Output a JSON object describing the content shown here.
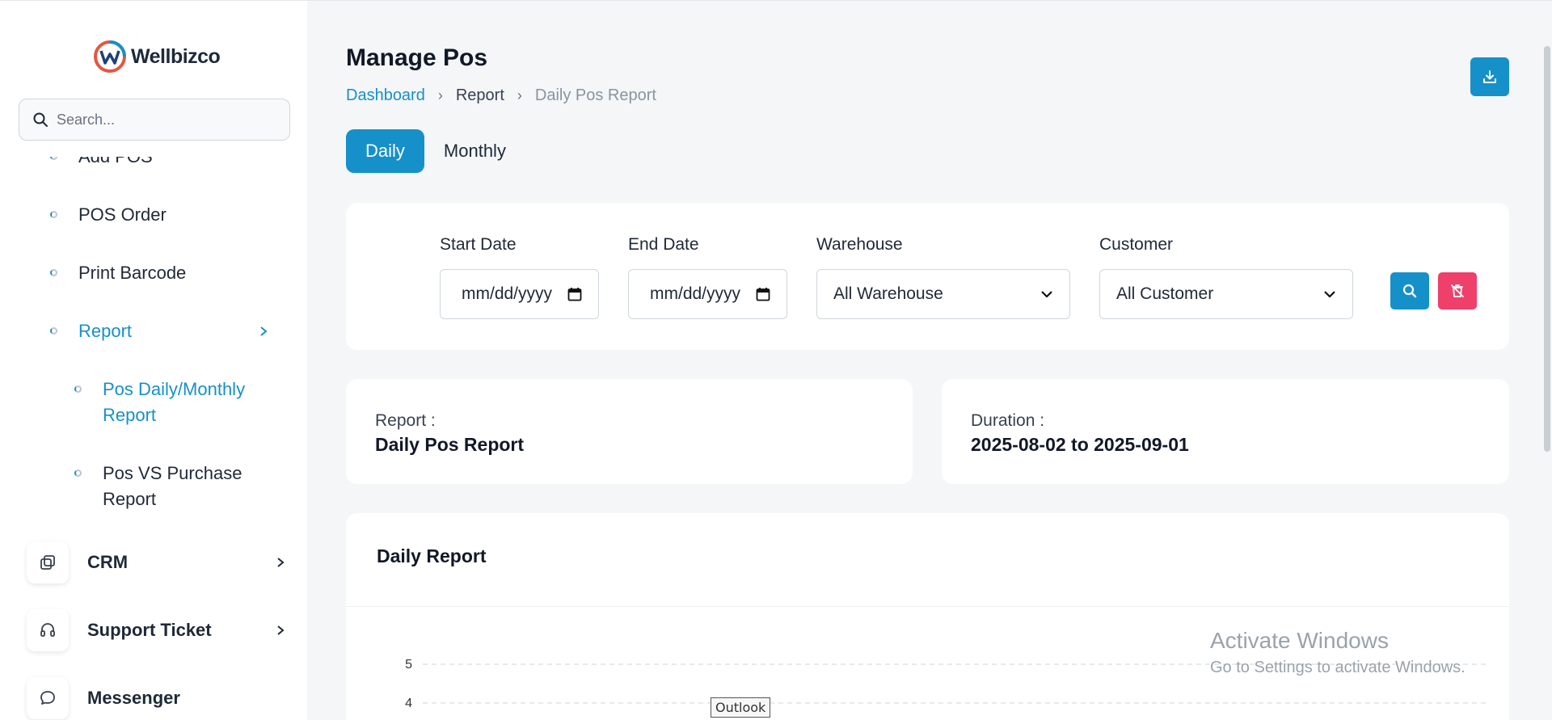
{
  "brand": {
    "name": "Wellbizco"
  },
  "search": {
    "placeholder": "Search..."
  },
  "sidebar": {
    "sub_items": [
      {
        "label": "Add POS"
      },
      {
        "label": "POS Order"
      },
      {
        "label": "Print Barcode"
      },
      {
        "label": "Report"
      }
    ],
    "report_children": [
      {
        "label": "Pos Daily/Monthly Report"
      },
      {
        "label": "Pos VS Purchase Report"
      }
    ],
    "main_items": [
      {
        "label": "CRM"
      },
      {
        "label": "Support Ticket"
      },
      {
        "label": "Messenger"
      }
    ]
  },
  "header": {
    "title": "Manage Pos",
    "breadcrumb": [
      "Dashboard",
      "Report",
      "Daily Pos Report"
    ]
  },
  "tabs": [
    {
      "label": "Daily"
    },
    {
      "label": "Monthly"
    }
  ],
  "filters": {
    "start_date_label": "Start Date",
    "start_date_placeholder": "mm/dd/yyyy",
    "end_date_label": "End Date",
    "end_date_placeholder": "mm/dd/yyyy",
    "warehouse_label": "Warehouse",
    "warehouse_value": "All Warehouse",
    "customer_label": "Customer",
    "customer_value": "All Customer"
  },
  "info": {
    "report_label": "Report :",
    "report_value": "Daily Pos Report",
    "duration_label": "Duration :",
    "duration_value": "2025-08-02 to 2025-09-01"
  },
  "report": {
    "title": "Daily Report"
  },
  "chart_data": {
    "type": "line",
    "y_ticks": [
      "5",
      "4"
    ],
    "grid": true
  },
  "overlay": {
    "watermark_line1": "Activate Windows",
    "watermark_line2": "Go to Settings to activate Windows.",
    "tooltip": "Outlook"
  },
  "colors": {
    "accent": "#1690c9",
    "danger": "#ef3f6b"
  }
}
